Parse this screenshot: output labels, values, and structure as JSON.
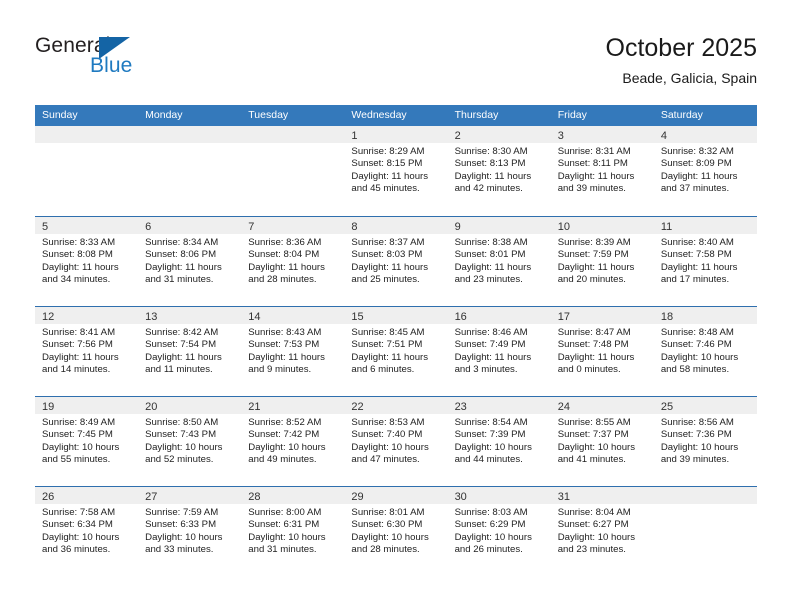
{
  "logo": {
    "word_top": "General",
    "word_bottom": "Blue",
    "triangle_color": "#1464a5",
    "blue_color": "#1f7ac0"
  },
  "header": {
    "title": "October 2025",
    "location": "Beade, Galicia, Spain"
  },
  "theme": {
    "header_row_bg": "#3479bb",
    "row_divider": "#2f6fae",
    "date_strip_bg": "#efefef"
  },
  "weekdays": [
    "Sunday",
    "Monday",
    "Tuesday",
    "Wednesday",
    "Thursday",
    "Friday",
    "Saturday"
  ],
  "weeks": [
    [
      {
        "empty": true
      },
      {
        "empty": true
      },
      {
        "empty": true
      },
      {
        "date": "1",
        "sunrise": "Sunrise: 8:29 AM",
        "sunset": "Sunset: 8:15 PM",
        "daylight1": "Daylight: 11 hours",
        "daylight2": "and 45 minutes."
      },
      {
        "date": "2",
        "sunrise": "Sunrise: 8:30 AM",
        "sunset": "Sunset: 8:13 PM",
        "daylight1": "Daylight: 11 hours",
        "daylight2": "and 42 minutes."
      },
      {
        "date": "3",
        "sunrise": "Sunrise: 8:31 AM",
        "sunset": "Sunset: 8:11 PM",
        "daylight1": "Daylight: 11 hours",
        "daylight2": "and 39 minutes."
      },
      {
        "date": "4",
        "sunrise": "Sunrise: 8:32 AM",
        "sunset": "Sunset: 8:09 PM",
        "daylight1": "Daylight: 11 hours",
        "daylight2": "and 37 minutes."
      }
    ],
    [
      {
        "date": "5",
        "sunrise": "Sunrise: 8:33 AM",
        "sunset": "Sunset: 8:08 PM",
        "daylight1": "Daylight: 11 hours",
        "daylight2": "and 34 minutes."
      },
      {
        "date": "6",
        "sunrise": "Sunrise: 8:34 AM",
        "sunset": "Sunset: 8:06 PM",
        "daylight1": "Daylight: 11 hours",
        "daylight2": "and 31 minutes."
      },
      {
        "date": "7",
        "sunrise": "Sunrise: 8:36 AM",
        "sunset": "Sunset: 8:04 PM",
        "daylight1": "Daylight: 11 hours",
        "daylight2": "and 28 minutes."
      },
      {
        "date": "8",
        "sunrise": "Sunrise: 8:37 AM",
        "sunset": "Sunset: 8:03 PM",
        "daylight1": "Daylight: 11 hours",
        "daylight2": "and 25 minutes."
      },
      {
        "date": "9",
        "sunrise": "Sunrise: 8:38 AM",
        "sunset": "Sunset: 8:01 PM",
        "daylight1": "Daylight: 11 hours",
        "daylight2": "and 23 minutes."
      },
      {
        "date": "10",
        "sunrise": "Sunrise: 8:39 AM",
        "sunset": "Sunset: 7:59 PM",
        "daylight1": "Daylight: 11 hours",
        "daylight2": "and 20 minutes."
      },
      {
        "date": "11",
        "sunrise": "Sunrise: 8:40 AM",
        "sunset": "Sunset: 7:58 PM",
        "daylight1": "Daylight: 11 hours",
        "daylight2": "and 17 minutes."
      }
    ],
    [
      {
        "date": "12",
        "sunrise": "Sunrise: 8:41 AM",
        "sunset": "Sunset: 7:56 PM",
        "daylight1": "Daylight: 11 hours",
        "daylight2": "and 14 minutes."
      },
      {
        "date": "13",
        "sunrise": "Sunrise: 8:42 AM",
        "sunset": "Sunset: 7:54 PM",
        "daylight1": "Daylight: 11 hours",
        "daylight2": "and 11 minutes."
      },
      {
        "date": "14",
        "sunrise": "Sunrise: 8:43 AM",
        "sunset": "Sunset: 7:53 PM",
        "daylight1": "Daylight: 11 hours",
        "daylight2": "and 9 minutes."
      },
      {
        "date": "15",
        "sunrise": "Sunrise: 8:45 AM",
        "sunset": "Sunset: 7:51 PM",
        "daylight1": "Daylight: 11 hours",
        "daylight2": "and 6 minutes."
      },
      {
        "date": "16",
        "sunrise": "Sunrise: 8:46 AM",
        "sunset": "Sunset: 7:49 PM",
        "daylight1": "Daylight: 11 hours",
        "daylight2": "and 3 minutes."
      },
      {
        "date": "17",
        "sunrise": "Sunrise: 8:47 AM",
        "sunset": "Sunset: 7:48 PM",
        "daylight1": "Daylight: 11 hours",
        "daylight2": "and 0 minutes."
      },
      {
        "date": "18",
        "sunrise": "Sunrise: 8:48 AM",
        "sunset": "Sunset: 7:46 PM",
        "daylight1": "Daylight: 10 hours",
        "daylight2": "and 58 minutes."
      }
    ],
    [
      {
        "date": "19",
        "sunrise": "Sunrise: 8:49 AM",
        "sunset": "Sunset: 7:45 PM",
        "daylight1": "Daylight: 10 hours",
        "daylight2": "and 55 minutes."
      },
      {
        "date": "20",
        "sunrise": "Sunrise: 8:50 AM",
        "sunset": "Sunset: 7:43 PM",
        "daylight1": "Daylight: 10 hours",
        "daylight2": "and 52 minutes."
      },
      {
        "date": "21",
        "sunrise": "Sunrise: 8:52 AM",
        "sunset": "Sunset: 7:42 PM",
        "daylight1": "Daylight: 10 hours",
        "daylight2": "and 49 minutes."
      },
      {
        "date": "22",
        "sunrise": "Sunrise: 8:53 AM",
        "sunset": "Sunset: 7:40 PM",
        "daylight1": "Daylight: 10 hours",
        "daylight2": "and 47 minutes."
      },
      {
        "date": "23",
        "sunrise": "Sunrise: 8:54 AM",
        "sunset": "Sunset: 7:39 PM",
        "daylight1": "Daylight: 10 hours",
        "daylight2": "and 44 minutes."
      },
      {
        "date": "24",
        "sunrise": "Sunrise: 8:55 AM",
        "sunset": "Sunset: 7:37 PM",
        "daylight1": "Daylight: 10 hours",
        "daylight2": "and 41 minutes."
      },
      {
        "date": "25",
        "sunrise": "Sunrise: 8:56 AM",
        "sunset": "Sunset: 7:36 PM",
        "daylight1": "Daylight: 10 hours",
        "daylight2": "and 39 minutes."
      }
    ],
    [
      {
        "date": "26",
        "sunrise": "Sunrise: 7:58 AM",
        "sunset": "Sunset: 6:34 PM",
        "daylight1": "Daylight: 10 hours",
        "daylight2": "and 36 minutes."
      },
      {
        "date": "27",
        "sunrise": "Sunrise: 7:59 AM",
        "sunset": "Sunset: 6:33 PM",
        "daylight1": "Daylight: 10 hours",
        "daylight2": "and 33 minutes."
      },
      {
        "date": "28",
        "sunrise": "Sunrise: 8:00 AM",
        "sunset": "Sunset: 6:31 PM",
        "daylight1": "Daylight: 10 hours",
        "daylight2": "and 31 minutes."
      },
      {
        "date": "29",
        "sunrise": "Sunrise: 8:01 AM",
        "sunset": "Sunset: 6:30 PM",
        "daylight1": "Daylight: 10 hours",
        "daylight2": "and 28 minutes."
      },
      {
        "date": "30",
        "sunrise": "Sunrise: 8:03 AM",
        "sunset": "Sunset: 6:29 PM",
        "daylight1": "Daylight: 10 hours",
        "daylight2": "and 26 minutes."
      },
      {
        "date": "31",
        "sunrise": "Sunrise: 8:04 AM",
        "sunset": "Sunset: 6:27 PM",
        "daylight1": "Daylight: 10 hours",
        "daylight2": "and 23 minutes."
      },
      {
        "empty": true
      }
    ]
  ]
}
